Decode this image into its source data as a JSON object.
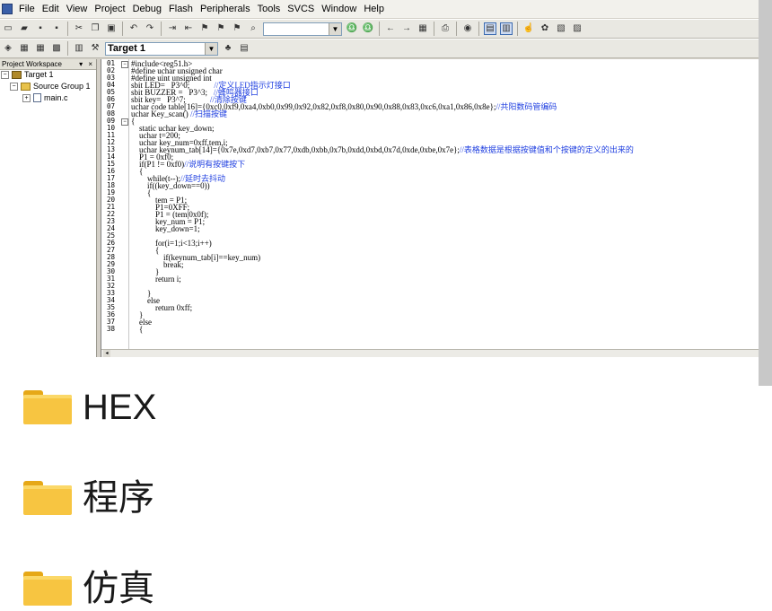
{
  "menu": [
    "File",
    "Edit",
    "View",
    "Project",
    "Debug",
    "Flash",
    "Peripherals",
    "Tools",
    "SVCS",
    "Window",
    "Help"
  ],
  "toolbar": {
    "target": "Target 1"
  },
  "workspace": {
    "title": "Project Workspace",
    "controls": "▾ ×",
    "tree": [
      {
        "label": "Target 1",
        "exp": "−"
      },
      {
        "label": "Source Group 1",
        "exp": "−"
      },
      {
        "label": "main.c",
        "exp": "+"
      }
    ]
  },
  "code": [
    {
      "n": "01",
      "t": "#include<reg51.h>",
      "c": ""
    },
    {
      "n": "02",
      "t": "#define uchar unsigned char",
      "c": ""
    },
    {
      "n": "03",
      "t": "#define uint unsigned int",
      "c": ""
    },
    {
      "n": "04",
      "t": "sbit LED=   P3^0;            ",
      "c": "//定义LED指示灯接口"
    },
    {
      "n": "05",
      "t": "sbit BUZZER =   P3^3;   ",
      "c": "//蜂鸣器接口"
    },
    {
      "n": "06",
      "t": "sbit key=   P3^7;            ",
      "c": "//清除按键"
    },
    {
      "n": "07",
      "t": "uchar code table[16]={0xc0,0xf9,0xa4,0xb0,0x99,0x92,0x82,0xf8,0x80,0x90,0x88,0x83,0xc6,0xa1,0x86,0x8e};",
      "c": "//共阳数码管编码"
    },
    {
      "n": "08",
      "t": "uchar Key_scan() ",
      "c": "//扫描按键"
    },
    {
      "n": "09",
      "t": "{",
      "c": ""
    },
    {
      "n": "10",
      "t": "    static uchar key_down;",
      "c": ""
    },
    {
      "n": "11",
      "t": "    uchar t=200;",
      "c": ""
    },
    {
      "n": "12",
      "t": "    uchar key_num=0xff,tem,i;",
      "c": ""
    },
    {
      "n": "13",
      "t": "    uchar keynum_tab[14]={0x7e,0xd7,0xb7,0x77,0xdb,0xbb,0x7b,0xdd,0xbd,0x7d,0xde,0xbe,0x7e};",
      "c": "//表格数据是根据按键值和个按键的定义的出来的"
    },
    {
      "n": "14",
      "t": "    P1 = 0xf0;",
      "c": ""
    },
    {
      "n": "15",
      "t": "    if(P1 != 0xf0)",
      "c": "//说明有按键按下"
    },
    {
      "n": "16",
      "t": "    {",
      "c": ""
    },
    {
      "n": "17",
      "t": "        while(t--);",
      "c": "//延时去抖动"
    },
    {
      "n": "18",
      "t": "        if((key_down==0))",
      "c": ""
    },
    {
      "n": "19",
      "t": "        {",
      "c": ""
    },
    {
      "n": "20",
      "t": "            tem = P1;",
      "c": ""
    },
    {
      "n": "21",
      "t": "            P1=0XFF;",
      "c": ""
    },
    {
      "n": "22",
      "t": "            P1 = (tem|0x0f);",
      "c": ""
    },
    {
      "n": "23",
      "t": "            key_num = P1;",
      "c": ""
    },
    {
      "n": "24",
      "t": "            key_down=1;",
      "c": ""
    },
    {
      "n": "25",
      "t": "",
      "c": ""
    },
    {
      "n": "26",
      "t": "            for(i=1;i<13;i++)",
      "c": ""
    },
    {
      "n": "27",
      "t": "            {",
      "c": ""
    },
    {
      "n": "28",
      "t": "                if(keynum_tab[i]==key_num)",
      "c": ""
    },
    {
      "n": "29",
      "t": "                break;",
      "c": ""
    },
    {
      "n": "30",
      "t": "            }",
      "c": ""
    },
    {
      "n": "31",
      "t": "            return i;",
      "c": ""
    },
    {
      "n": "32",
      "t": "",
      "c": ""
    },
    {
      "n": "33",
      "t": "        }",
      "c": ""
    },
    {
      "n": "34",
      "t": "        else",
      "c": ""
    },
    {
      "n": "35",
      "t": "            return 0xff;",
      "c": ""
    },
    {
      "n": "36",
      "t": "    }",
      "c": ""
    },
    {
      "n": "37",
      "t": "    else",
      "c": ""
    },
    {
      "n": "38",
      "t": "    {",
      "c": ""
    }
  ],
  "folders": [
    {
      "label": "HEX"
    },
    {
      "label": "程序"
    },
    {
      "label": "仿真"
    }
  ]
}
